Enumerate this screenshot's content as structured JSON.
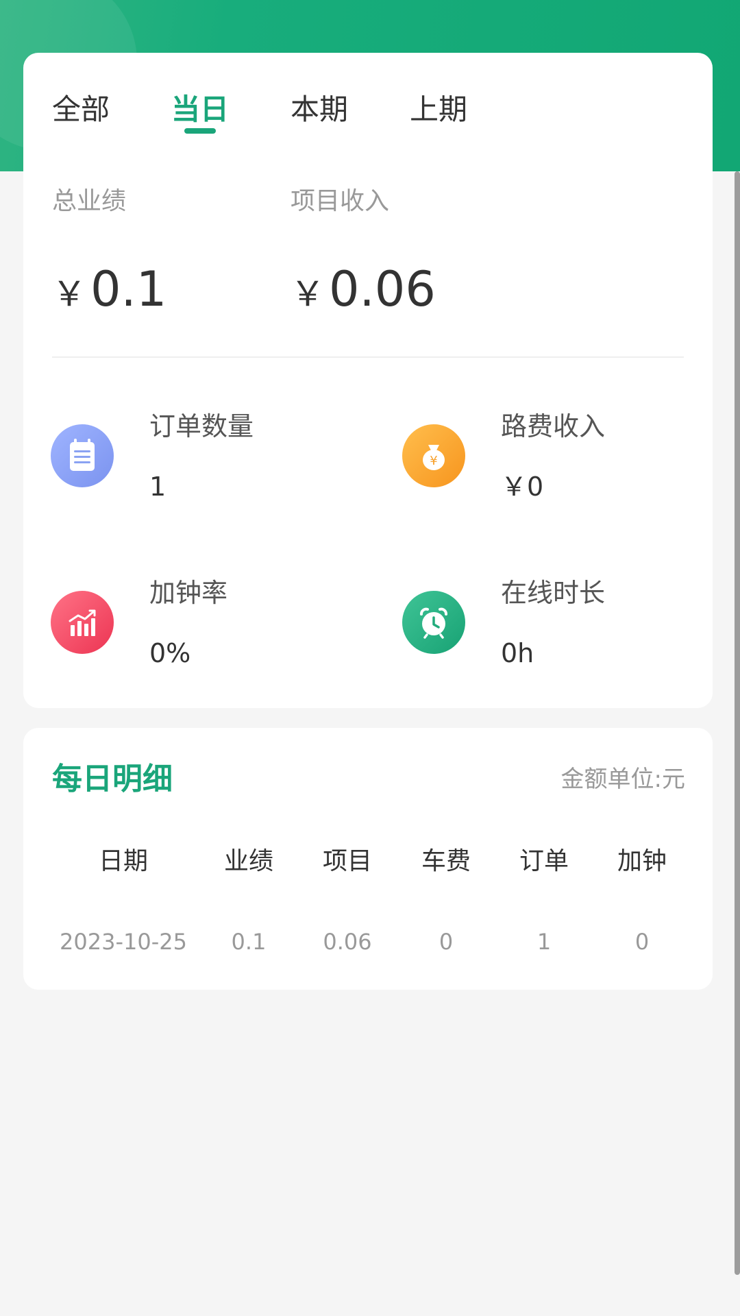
{
  "tabs": [
    {
      "label": "全部",
      "active": false
    },
    {
      "label": "当日",
      "active": true
    },
    {
      "label": "本期",
      "active": false
    },
    {
      "label": "上期",
      "active": false
    }
  ],
  "summary": {
    "total_label": "总业绩",
    "total_currency": "￥",
    "total_value": "0.1",
    "project_label": "项目收入",
    "project_currency": "￥",
    "project_value": "0.06"
  },
  "stats": {
    "orders": {
      "label": "订单数量",
      "value": "1",
      "icon": "calendar-list-icon",
      "color": "#7f9cf5"
    },
    "travel": {
      "label": "路费收入",
      "value": "￥0",
      "icon": "money-bag-icon",
      "color": "#f8a430"
    },
    "overtime": {
      "label": "加钟率",
      "value": "0%",
      "icon": "bar-chart-icon",
      "color": "#f0445f"
    },
    "online": {
      "label": "在线时长",
      "value": "0h",
      "icon": "alarm-clock-icon",
      "color": "#23b07f"
    }
  },
  "detail": {
    "title": "每日明细",
    "unit": "金额单位:元",
    "columns": [
      "日期",
      "业绩",
      "项目",
      "车费",
      "订单",
      "加钟"
    ],
    "rows": [
      [
        "2023-10-25",
        "0.1",
        "0.06",
        "0",
        "1",
        "0"
      ]
    ]
  },
  "colors": {
    "brand": "#1aa57a",
    "header": "#18ad7c"
  }
}
